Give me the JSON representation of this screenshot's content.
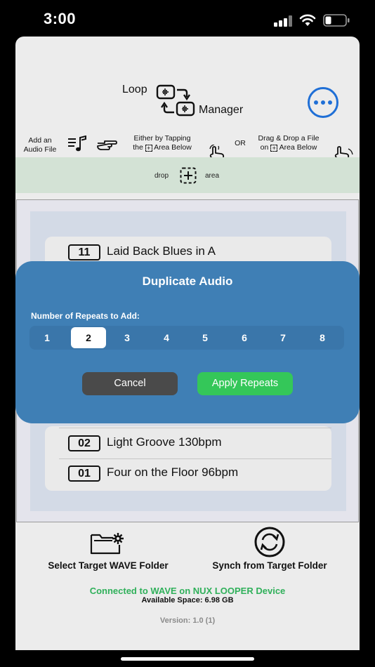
{
  "status_bar": {
    "time": "3:00"
  },
  "header": {
    "title_word_1": "Loop",
    "title_word_2": "Manager",
    "more_icon": "ellipsis-circle-icon"
  },
  "hints": {
    "add_line1": "Add an",
    "add_line2": "Audio File",
    "either_line1": "Either by Tapping",
    "either_line2_pre": "the",
    "either_line2_post": "Area Below",
    "or": "OR",
    "drag_line1": "Drag & Drop a File",
    "drag_line2_pre": "on",
    "drag_line2_post": "Area Below"
  },
  "drop_area": {
    "left_label": "drop",
    "right_label": "area"
  },
  "loops": [
    {
      "number": "11",
      "name": "Laid Back Blues in A"
    },
    {
      "number": "02",
      "name": "Light Groove 130bpm"
    },
    {
      "number": "01",
      "name": "Four on the Floor 96bpm"
    }
  ],
  "modal": {
    "title": "Duplicate Audio",
    "label": "Number of Repeats to Add:",
    "options": [
      "1",
      "2",
      "3",
      "4",
      "5",
      "6",
      "7",
      "8"
    ],
    "selected": "2",
    "cancel_label": "Cancel",
    "apply_label": "Apply Repeats"
  },
  "footer": {
    "select_folder_label": "Select Target WAVE Folder",
    "synch_label": "Synch from Target Folder",
    "connected": "Connected to WAVE on NUX LOOPER Device",
    "available_space": "Available Space: 6.98 GB",
    "version": "Version: 1.0 (1)"
  },
  "colors": {
    "accent_blue": "#1f6fd6",
    "modal_bg": "#3f7fb5",
    "apply_green": "#34c759",
    "connected_green": "#2fb05a"
  }
}
